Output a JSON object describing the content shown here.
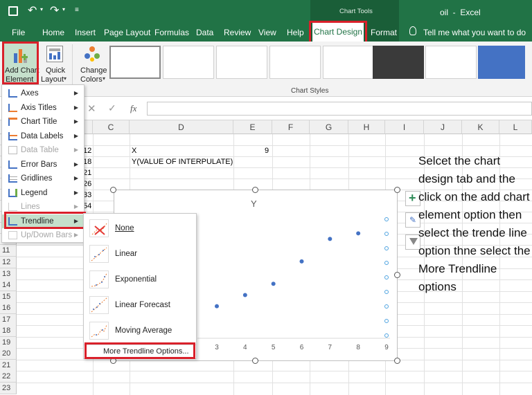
{
  "titlebar": {
    "chart_tools": "Chart Tools",
    "doc_title": "oil  -  Excel"
  },
  "tabs": [
    "File",
    "Home",
    "Insert",
    "Page Layout",
    "Formulas",
    "Data",
    "Review",
    "View",
    "Help",
    "Chart Design",
    "Format"
  ],
  "tell_me": "Tell me what you want to do",
  "ribbon": {
    "add_chart_line1": "Add Chart",
    "add_chart_line2": "Element",
    "quick_line1": "Quick",
    "quick_line2": "Layout",
    "change_line1": "Change",
    "change_line2": "Colors",
    "chart_styles": "Chart Styles",
    "fx": "fx"
  },
  "columns": [
    "C",
    "D",
    "E",
    "F",
    "G",
    "H",
    "I",
    "J",
    "K",
    "L"
  ],
  "rows": [
    "11",
    "12",
    "13",
    "14",
    "15",
    "16",
    "17",
    "18",
    "19",
    "20",
    "21",
    "22",
    "23"
  ],
  "cells": {
    "x_label": "X",
    "x_value": "9",
    "y_label": "Y(VALUE OF INTERPULATE)",
    "b_vals": [
      "12",
      "18",
      "21",
      "26",
      "33",
      "54"
    ]
  },
  "menu_items": [
    {
      "label": "Axes",
      "disabled": false
    },
    {
      "label": "Axis Titles",
      "disabled": false
    },
    {
      "label": "Chart Title",
      "disabled": false
    },
    {
      "label": "Data Labels",
      "disabled": false
    },
    {
      "label": "Data Table",
      "disabled": true
    },
    {
      "label": "Error Bars",
      "disabled": false
    },
    {
      "label": "Gridlines",
      "disabled": false
    },
    {
      "label": "Legend",
      "disabled": false
    },
    {
      "label": "Lines",
      "disabled": true
    },
    {
      "label": "Trendline",
      "disabled": false
    },
    {
      "label": "Up/Down Bars",
      "disabled": true
    }
  ],
  "trend_items": [
    "None",
    "Linear",
    "Exponential",
    "Linear Forecast",
    "Moving Average"
  ],
  "more_trend": "More Trendline Options...",
  "chart_data": {
    "type": "scatter",
    "title": "Y",
    "x": [
      3,
      4,
      5,
      6,
      7,
      8
    ],
    "y": [
      1.5,
      2.5,
      3.5,
      5.5,
      7.5,
      8
    ],
    "xticks": [
      "3",
      "4",
      "5",
      "6",
      "7",
      "8",
      "9"
    ],
    "marker_color": "#4472c4"
  },
  "annotation": "Selcet the chart design tab and the click on the add chart element option then select the trende line option thne  select the More Trendline options",
  "colors": {
    "excel_green": "#217346",
    "highlight_red": "#d9202a",
    "marker_blue": "#4472c4"
  }
}
